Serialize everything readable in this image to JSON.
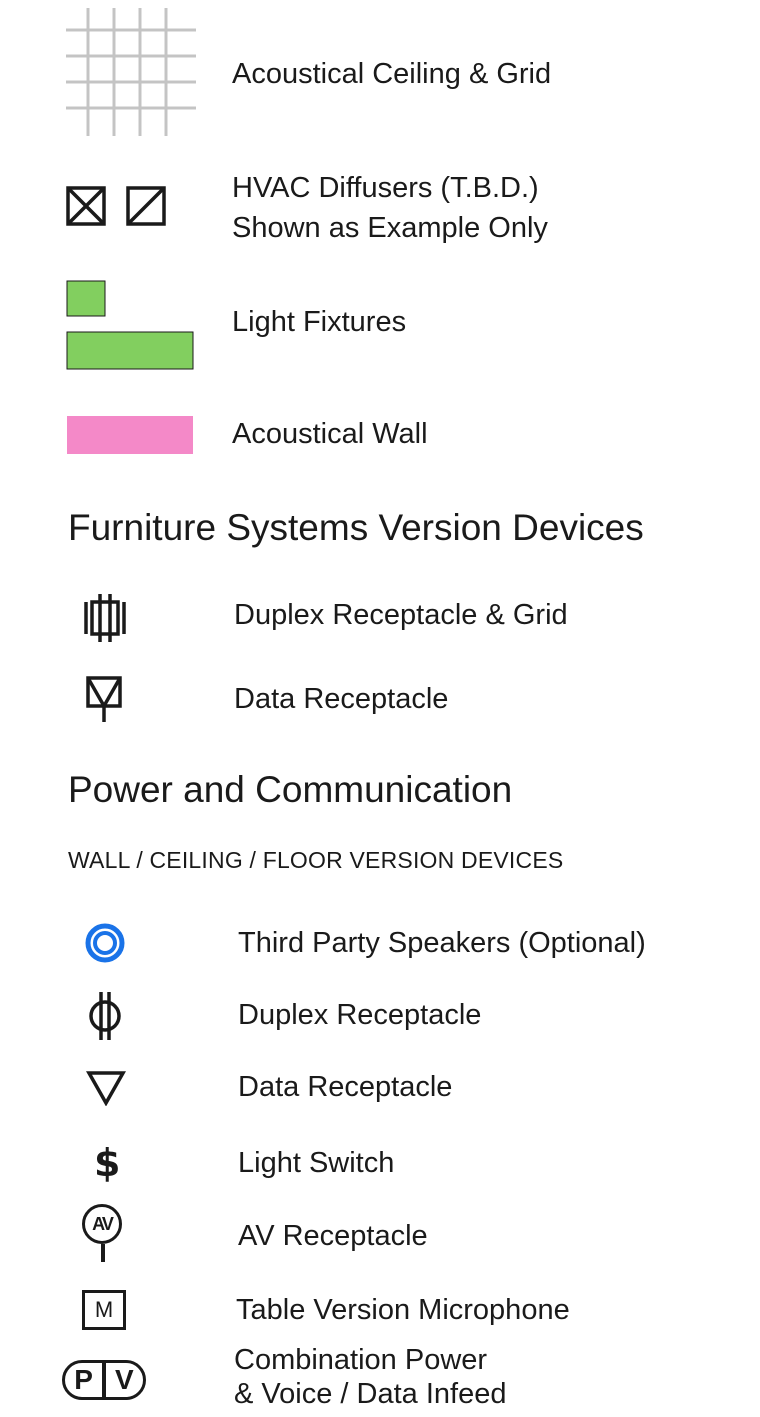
{
  "colors": {
    "grid": "#c4c4c4",
    "light_fixture": "#82cf5f",
    "acoustical_wall": "#f489c8",
    "speaker": "#1a73e8",
    "ink": "#1a1a1a"
  },
  "legend": {
    "ceiling_grid": {
      "label": "Acoustical Ceiling & Grid",
      "icon": "ceiling-grid-icon"
    },
    "hvac": {
      "line1": "HVAC Diffusers (T.B.D.)",
      "line2": "Shown as Example Only",
      "icon": "hvac-diffuser-icon"
    },
    "light_fixtures": {
      "label": "Light Fixtures",
      "icon": "light-fixture-icon"
    },
    "acoustical_wall": {
      "label": "Acoustical Wall",
      "icon": "acoustical-wall-icon"
    }
  },
  "furniture": {
    "heading": "Furniture Systems Version Devices",
    "duplex_grid": {
      "label": "Duplex Receptacle & Grid",
      "icon": "duplex-receptacle-grid-icon"
    },
    "data": {
      "label": "Data Receptacle",
      "icon": "data-receptacle-furniture-icon"
    }
  },
  "power": {
    "heading": "Power and Communication",
    "subheading": "WALL / CEILING / FLOOR VERSION DEVICES",
    "speakers": {
      "label": "Third Party Speakers (Optional)",
      "icon": "speaker-icon"
    },
    "duplex": {
      "label": "Duplex Receptacle",
      "icon": "duplex-receptacle-icon"
    },
    "data": {
      "label": "Data Receptacle",
      "icon": "data-receptacle-icon"
    },
    "switch": {
      "label": "Light Switch",
      "glyph": "$",
      "icon": "light-switch-icon"
    },
    "av": {
      "label": "AV Receptacle",
      "glyph": "AV",
      "icon": "av-receptacle-icon"
    },
    "mic": {
      "label": "Table Version Microphone",
      "glyph": "M",
      "icon": "microphone-icon"
    },
    "infeed": {
      "line1": "Combination Power",
      "line2": "& Voice / Data Infeed",
      "glyph_p": "P",
      "glyph_v": "V",
      "icon": "power-voice-data-infeed-icon"
    }
  }
}
